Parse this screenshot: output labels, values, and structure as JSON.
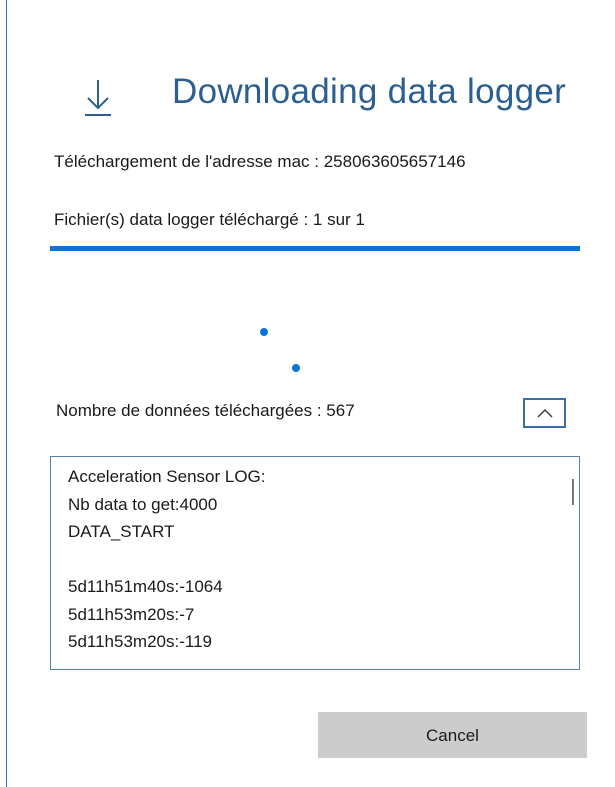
{
  "header": {
    "title": "Downloading data logger",
    "icon": "download-arrow-icon"
  },
  "status": {
    "mac_line": "Téléchargement de l'adresse mac : 258063605657146",
    "files_line": "Fichier(s) data logger téléchargé : 1 sur 1",
    "progress": 1.0,
    "count_line": "Nombre de données téléchargées : 567"
  },
  "log": {
    "lines": [
      "Acceleration Sensor LOG:",
      "Nb data to get:4000",
      "DATA_START",
      "",
      "5d11h51m40s:-1064",
      "5d11h53m20s:-7",
      "5d11h53m20s:-119"
    ]
  },
  "actions": {
    "cancel_label": "Cancel",
    "collapse_icon": "chevron-up-icon"
  },
  "colors": {
    "accent": "#0a74d6",
    "title": "#2b5f8f",
    "button_bg": "#cccccc"
  }
}
